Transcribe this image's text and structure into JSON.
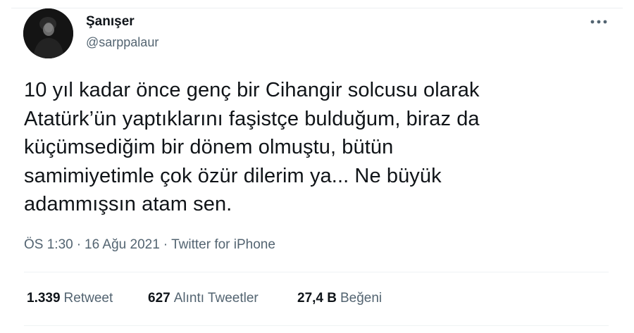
{
  "tweet": {
    "author": {
      "display_name": "Şanışer",
      "handle": "@sarppalaur",
      "avatar_icon": "profile-photo"
    },
    "more_icon": "more-options-icon",
    "text": "10 yıl kadar önce genç bir Cihangir solcusu olarak\nAtatürk’ün yaptıklarını faşistçe bulduğum, biraz da\nküçümsediğim bir dönem olmuştu, bütün\nsamimiyetimle çok özür dilerim ya... Ne büyük\nadammışsın atam sen.",
    "meta": {
      "time": "ÖS 1:30",
      "separator": "·",
      "date": "16 Ağu 2021",
      "source": "Twitter for iPhone"
    },
    "stats": {
      "retweets_count": "1.339",
      "retweets_label": "Retweet",
      "quotes_count": "627",
      "quotes_label": "Alıntı Tweetler",
      "likes_count": "27,4 B",
      "likes_label": "Beğeni"
    }
  },
  "colors": {
    "text_primary": "#0f1419",
    "text_secondary": "#536471",
    "divider": "#eff3f4",
    "background": "#ffffff"
  }
}
